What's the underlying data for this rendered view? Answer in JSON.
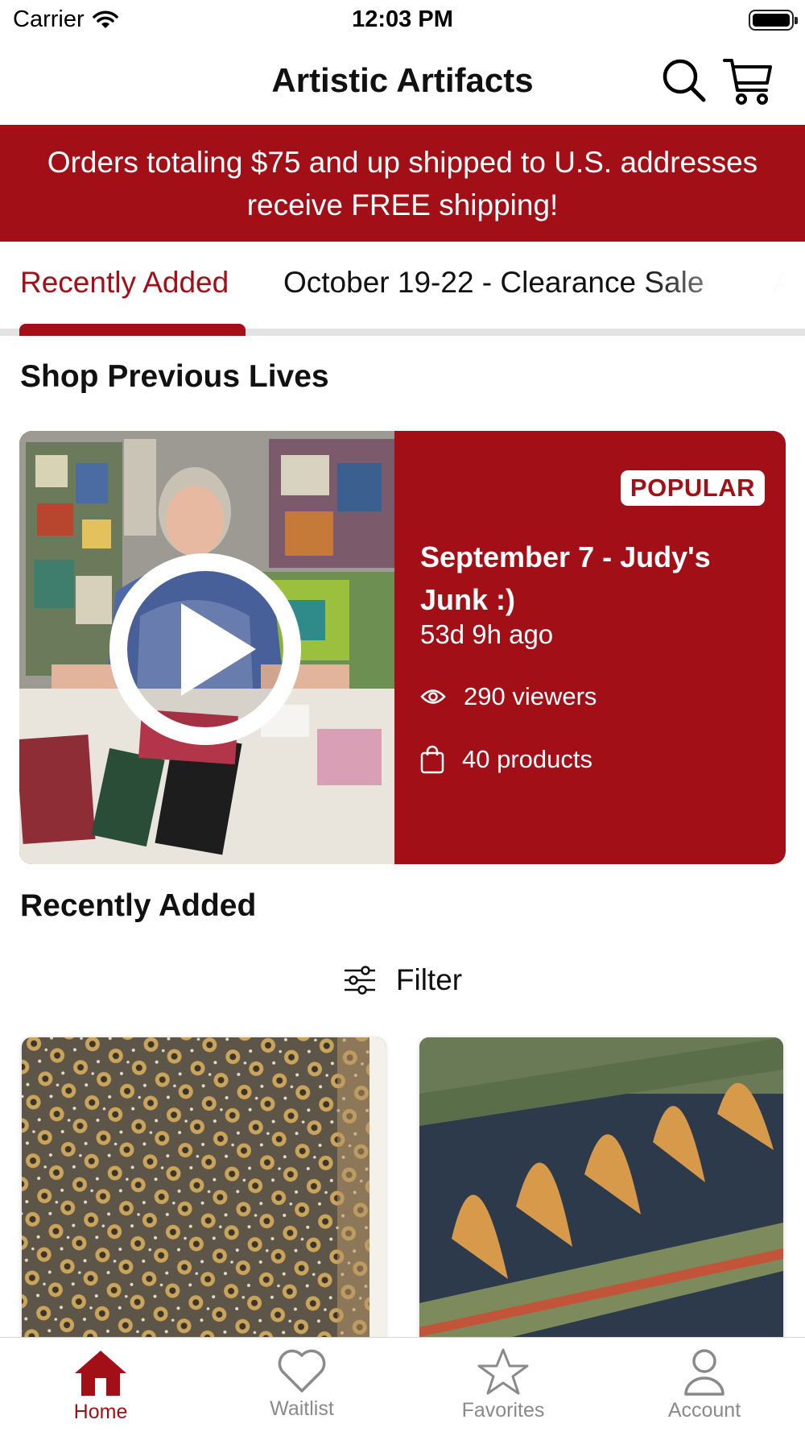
{
  "status_bar": {
    "carrier": "Carrier",
    "time": "12:03 PM"
  },
  "header": {
    "title": "Artistic Artifacts",
    "search_icon": "search-icon",
    "cart_icon": "cart-icon"
  },
  "banner": {
    "text": "Orders totaling $75 and up shipped to U.S. addresses receive FREE shipping!"
  },
  "tabs": {
    "items": [
      {
        "label": "Recently Added",
        "active": true
      },
      {
        "label": "October 19-22 -  Clearance Sale"
      },
      {
        "label": "A"
      }
    ]
  },
  "previous_lives": {
    "title": "Shop Previous Lives",
    "card": {
      "badge": "POPULAR",
      "title": "September 7 - Judy's Junk :)",
      "ago": "53d 9h ago",
      "viewers": "290 viewers",
      "products": "40 products"
    }
  },
  "recently_added": {
    "title": "Recently Added",
    "filter_label": "Filter"
  },
  "tab_bar": {
    "items": [
      {
        "label": "Home",
        "icon": "home-icon",
        "active": true
      },
      {
        "label": "Waitlist",
        "icon": "heart-icon"
      },
      {
        "label": "Favorites",
        "icon": "star-icon"
      },
      {
        "label": "Account",
        "icon": "person-icon"
      }
    ]
  },
  "colors": {
    "brand_red": "#a20f16",
    "inactive_gray": "#8a8a8a"
  }
}
